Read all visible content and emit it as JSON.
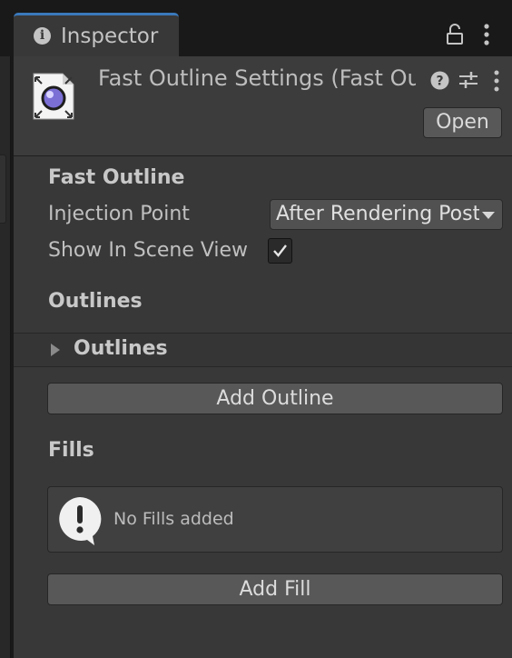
{
  "window": {
    "tab_label": "Inspector",
    "tab_icon": "info-icon",
    "accent": "#3a79bb"
  },
  "header": {
    "title": "Fast Outline Settings (Fast Outline)",
    "open_label": "Open"
  },
  "section_fast_outline": {
    "heading": "Fast Outline",
    "injection_point_label": "Injection Point",
    "injection_point_value": "After Rendering PostProcessing",
    "show_in_scene_view_label": "Show In Scene View",
    "show_in_scene_view_checked": true
  },
  "section_outlines": {
    "heading": "Outlines",
    "foldout_label": "Outlines",
    "foldout_expanded": false,
    "add_button_label": "Add Outline"
  },
  "section_fills": {
    "heading": "Fills",
    "empty_message": "No Fills added",
    "add_button_label": "Add Fill"
  }
}
